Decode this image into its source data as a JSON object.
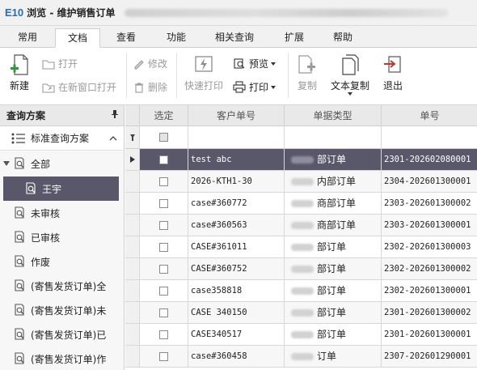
{
  "window": {
    "logo": "E10",
    "title": "浏览 - 维护销售订单"
  },
  "menu": {
    "tabs": [
      "常用",
      "文档",
      "查看",
      "功能",
      "相关查询",
      "扩展",
      "帮助"
    ],
    "active": "文档"
  },
  "ribbon": {
    "new": "新建",
    "open": "打开",
    "open_new_window": "在新窗口打开",
    "edit": "修改",
    "delete": "删除",
    "quick_print": "快速打印",
    "preview": "预览",
    "print": "打印",
    "copy": "复制",
    "text_copy": "文本复制",
    "exit": "退出"
  },
  "left_panel": {
    "header": "查询方案",
    "pin": "ᛘ",
    "plan": "标准查询方案",
    "items": [
      {
        "label": "全部",
        "expandable": true
      },
      {
        "label": "王宇",
        "selected": true
      },
      {
        "label": "未审核"
      },
      {
        "label": "已审核"
      },
      {
        "label": "作废"
      },
      {
        "label": "(寄售发货订单)全"
      },
      {
        "label": "(寄售发货订单)未"
      },
      {
        "label": "(寄售发货订单)已"
      },
      {
        "label": "(寄售发货订单)作"
      }
    ]
  },
  "grid": {
    "columns": [
      "选定",
      "客户单号",
      "单据类型",
      "单号"
    ],
    "rows": [
      {
        "customer_no": "test abc",
        "doc_type": "部订单",
        "order_no": "2301-202602080001",
        "selected": true
      },
      {
        "customer_no": "2026-KTH1-30",
        "doc_type": "内部订单",
        "order_no": "2304-202601300001"
      },
      {
        "customer_no": "case#360772",
        "doc_type": "商部订单",
        "order_no": "2303-202601300002"
      },
      {
        "customer_no": "case#360563",
        "doc_type": "商部订单",
        "order_no": "2303-202601300001"
      },
      {
        "customer_no": "CASE#361011",
        "doc_type": "部订单",
        "order_no": "2302-202601300003"
      },
      {
        "customer_no": "CASE#360752",
        "doc_type": "部订单",
        "order_no": "2302-202601300002"
      },
      {
        "customer_no": "case358818",
        "doc_type": "部订单",
        "order_no": "2302-202601300001"
      },
      {
        "customer_no": "CASE 340150",
        "doc_type": "部订单",
        "order_no": "2301-202601300002"
      },
      {
        "customer_no": "CASE340517",
        "doc_type": "部订单",
        "order_no": "2301-202601300001"
      },
      {
        "customer_no": "case#360458",
        "doc_type": "订单",
        "order_no": "2307-202601290001"
      }
    ]
  },
  "colors": {
    "accent": "#2b6cb0",
    "selection": "#58586a",
    "new_plus": "#2e9a3c",
    "exit_red": "#c0392b"
  }
}
